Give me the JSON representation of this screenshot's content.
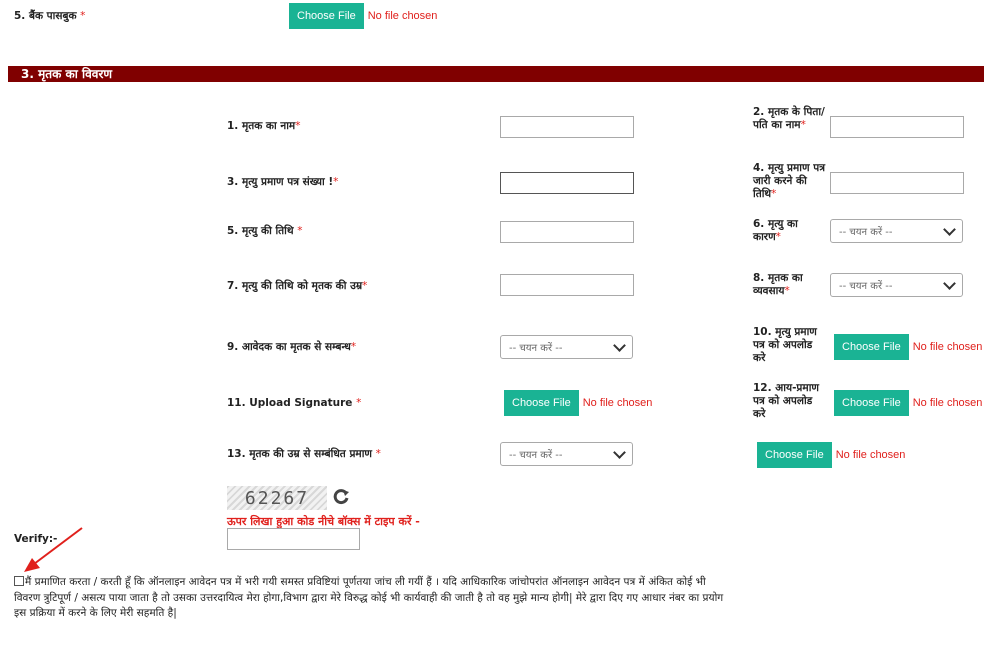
{
  "bank_passbook": {
    "label": "5. बैंक पासबुक",
    "required": "*",
    "button": "Choose File",
    "status": "No file chosen"
  },
  "section": {
    "title": "3. मृतक का विवरण"
  },
  "fields": {
    "f1": {
      "label": "1. मृतक का नाम",
      "required": "*"
    },
    "f2": {
      "label": "2. मृतक के पिता/पति का नाम",
      "required": "*"
    },
    "f3": {
      "label": "3. मृत्यु प्रमाण पत्र संख्या !",
      "required": "*"
    },
    "f4": {
      "label": "4. मृत्यु प्रमाण पत्र जारी करने की तिथि",
      "required": "*"
    },
    "f5": {
      "label": "5. मृत्यु की तिथि",
      "required": "*"
    },
    "f6": {
      "label": "6. मृत्यु का कारण",
      "required": "*",
      "selected": "-- चयन करें --"
    },
    "f7": {
      "label": "7. मृत्यु की तिथि को मृतक की उम्र",
      "required": "*"
    },
    "f8": {
      "label": "8. मृतक का व्यवसाय",
      "required": "*",
      "selected": "-- चयन करें --"
    },
    "f9": {
      "label": "9. आवेदक का मृतक से सम्बन्ध",
      "required": "*",
      "selected": "-- चयन करें --"
    },
    "f10": {
      "label": "10. मृत्यु प्रमाण पत्र को अपलोड करे",
      "button": "Choose File",
      "status": "No file chosen"
    },
    "f11": {
      "label": "11. Upload Signature",
      "required": "*",
      "button": "Choose File",
      "status": "No file chosen"
    },
    "f12": {
      "label": "12. आय-प्रमाण पत्र को अपलोड करे",
      "button": "Choose File",
      "status": "No file chosen"
    },
    "f13": {
      "label": "13. मृतक की उम्र से सम्बंधित प्रमाण",
      "required": "*",
      "selected": "-- चयन करें --",
      "button": "Choose File",
      "status": "No file chosen"
    }
  },
  "captcha": {
    "code": "62267",
    "instruction": "ऊपर लिखा हुआ कोड नीचे बॉक्स में टाइप करें -",
    "verify_label": "Verify:-",
    "refresh_icon": "refresh-icon"
  },
  "declaration": {
    "checked": false,
    "text": "मैं प्रमाणित करता / करती हूँ कि ऑनलाइन आवेदन पत्र में भरी गयी समस्त प्रविष्टियां पूर्णतया जांच ली गयीं हैं । यदि आधिकारिक जांचोपरांत ऑनलाइन आवेदन पत्र में अंकित कोई भी विवरण त्रुटिपूर्ण / असत्य पाया जाता है तो उसका उत्तरदायित्व मेरा होगा,विभाग द्वारा मेरे विरुद्ध कोई भी कार्यवाही की जाती है तो वह मुझे मान्य होगी| मेरे द्वारा दिए गए आधार नंबर का प्रयोग इस प्रक्रिया में करने के लिए मेरी सहमति है|"
  },
  "colors": {
    "section_bar": "#800000",
    "file_button": "#1ab394",
    "required": "#e0201c",
    "annotation_arrow": "#e0201c"
  }
}
